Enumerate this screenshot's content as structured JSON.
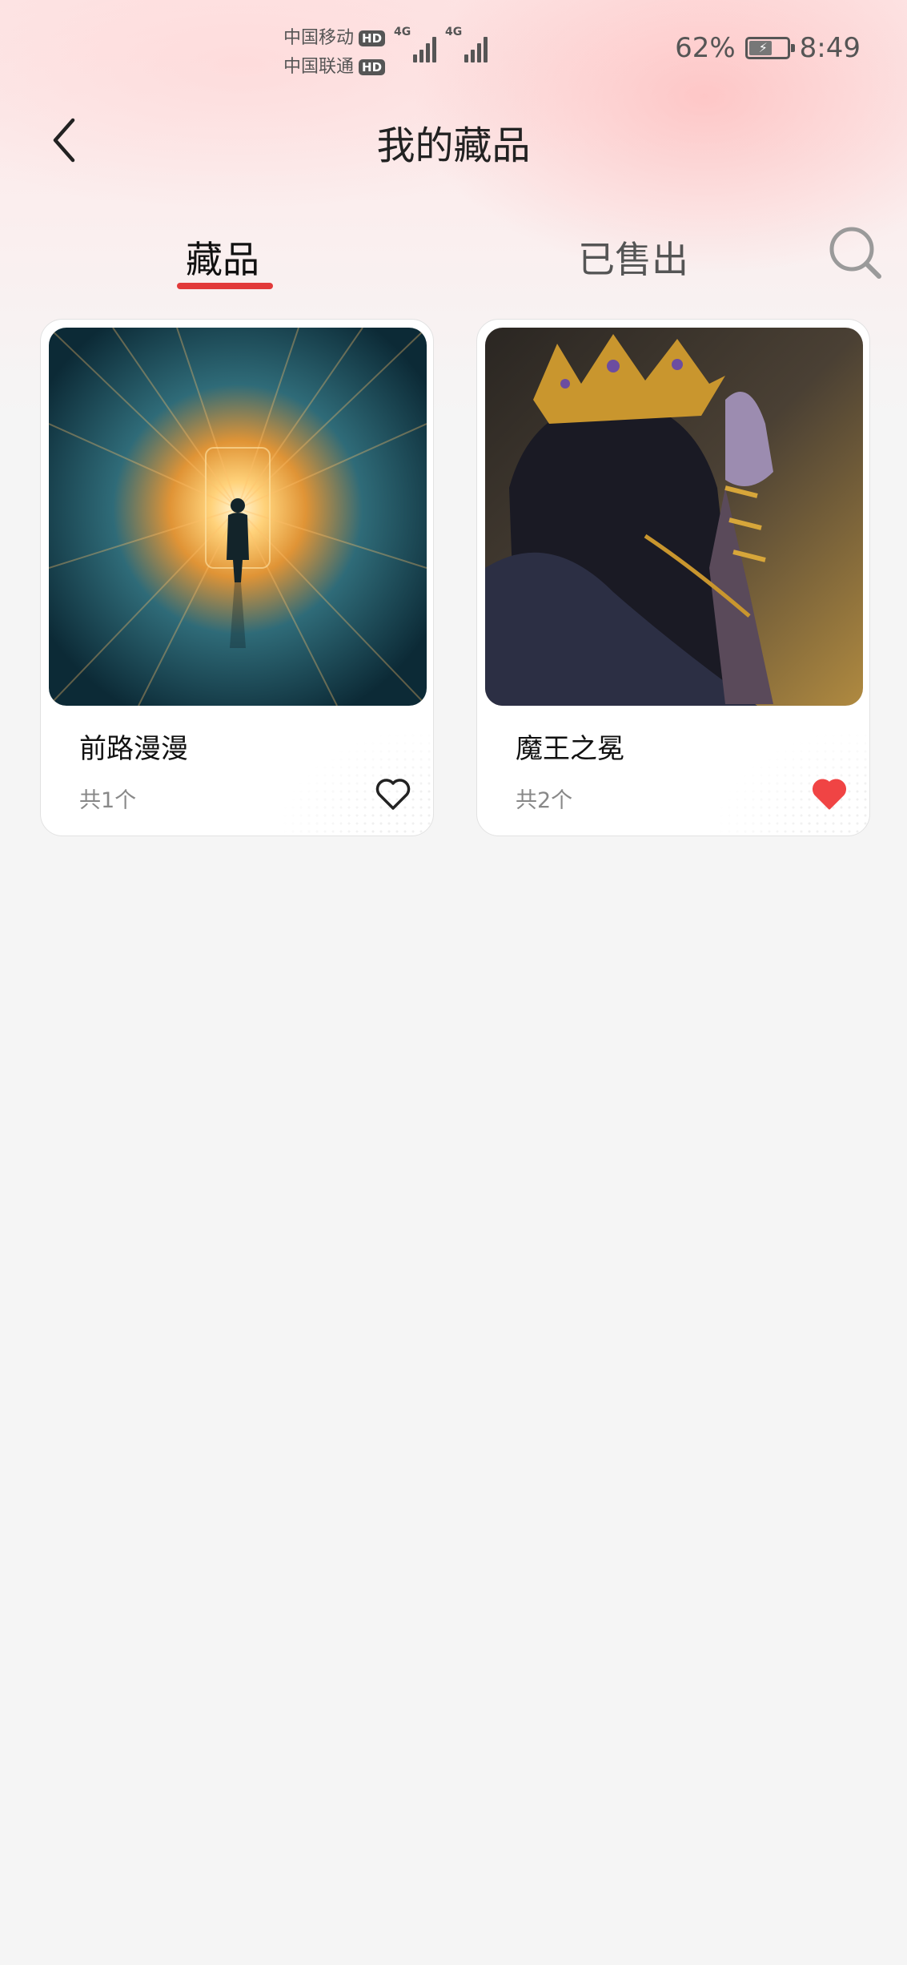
{
  "status_bar": {
    "carrier_1": "中国移动",
    "carrier_2": "中国联通",
    "hd_badge": "HD",
    "network_type": "4G",
    "battery_percent": "62%",
    "battery_level": 0.62,
    "time": "8:49"
  },
  "header": {
    "title": "我的藏品",
    "back_icon": "chevron-left-icon"
  },
  "tabs": {
    "items": [
      {
        "label": "藏品",
        "active": true
      },
      {
        "label": "已售出",
        "active": false
      }
    ],
    "accent_color": "#e23a3a",
    "search_icon": "search-icon"
  },
  "collection": {
    "items": [
      {
        "title": "前路漫漫",
        "count": "共1个",
        "favorited": false,
        "image": "glowing-tunnel-silhouette-image"
      },
      {
        "title": "魔王之冕",
        "count": "共2个",
        "favorited": true,
        "image": "dark-king-crown-painting-image"
      }
    ],
    "favorite_color": "#f04444"
  }
}
